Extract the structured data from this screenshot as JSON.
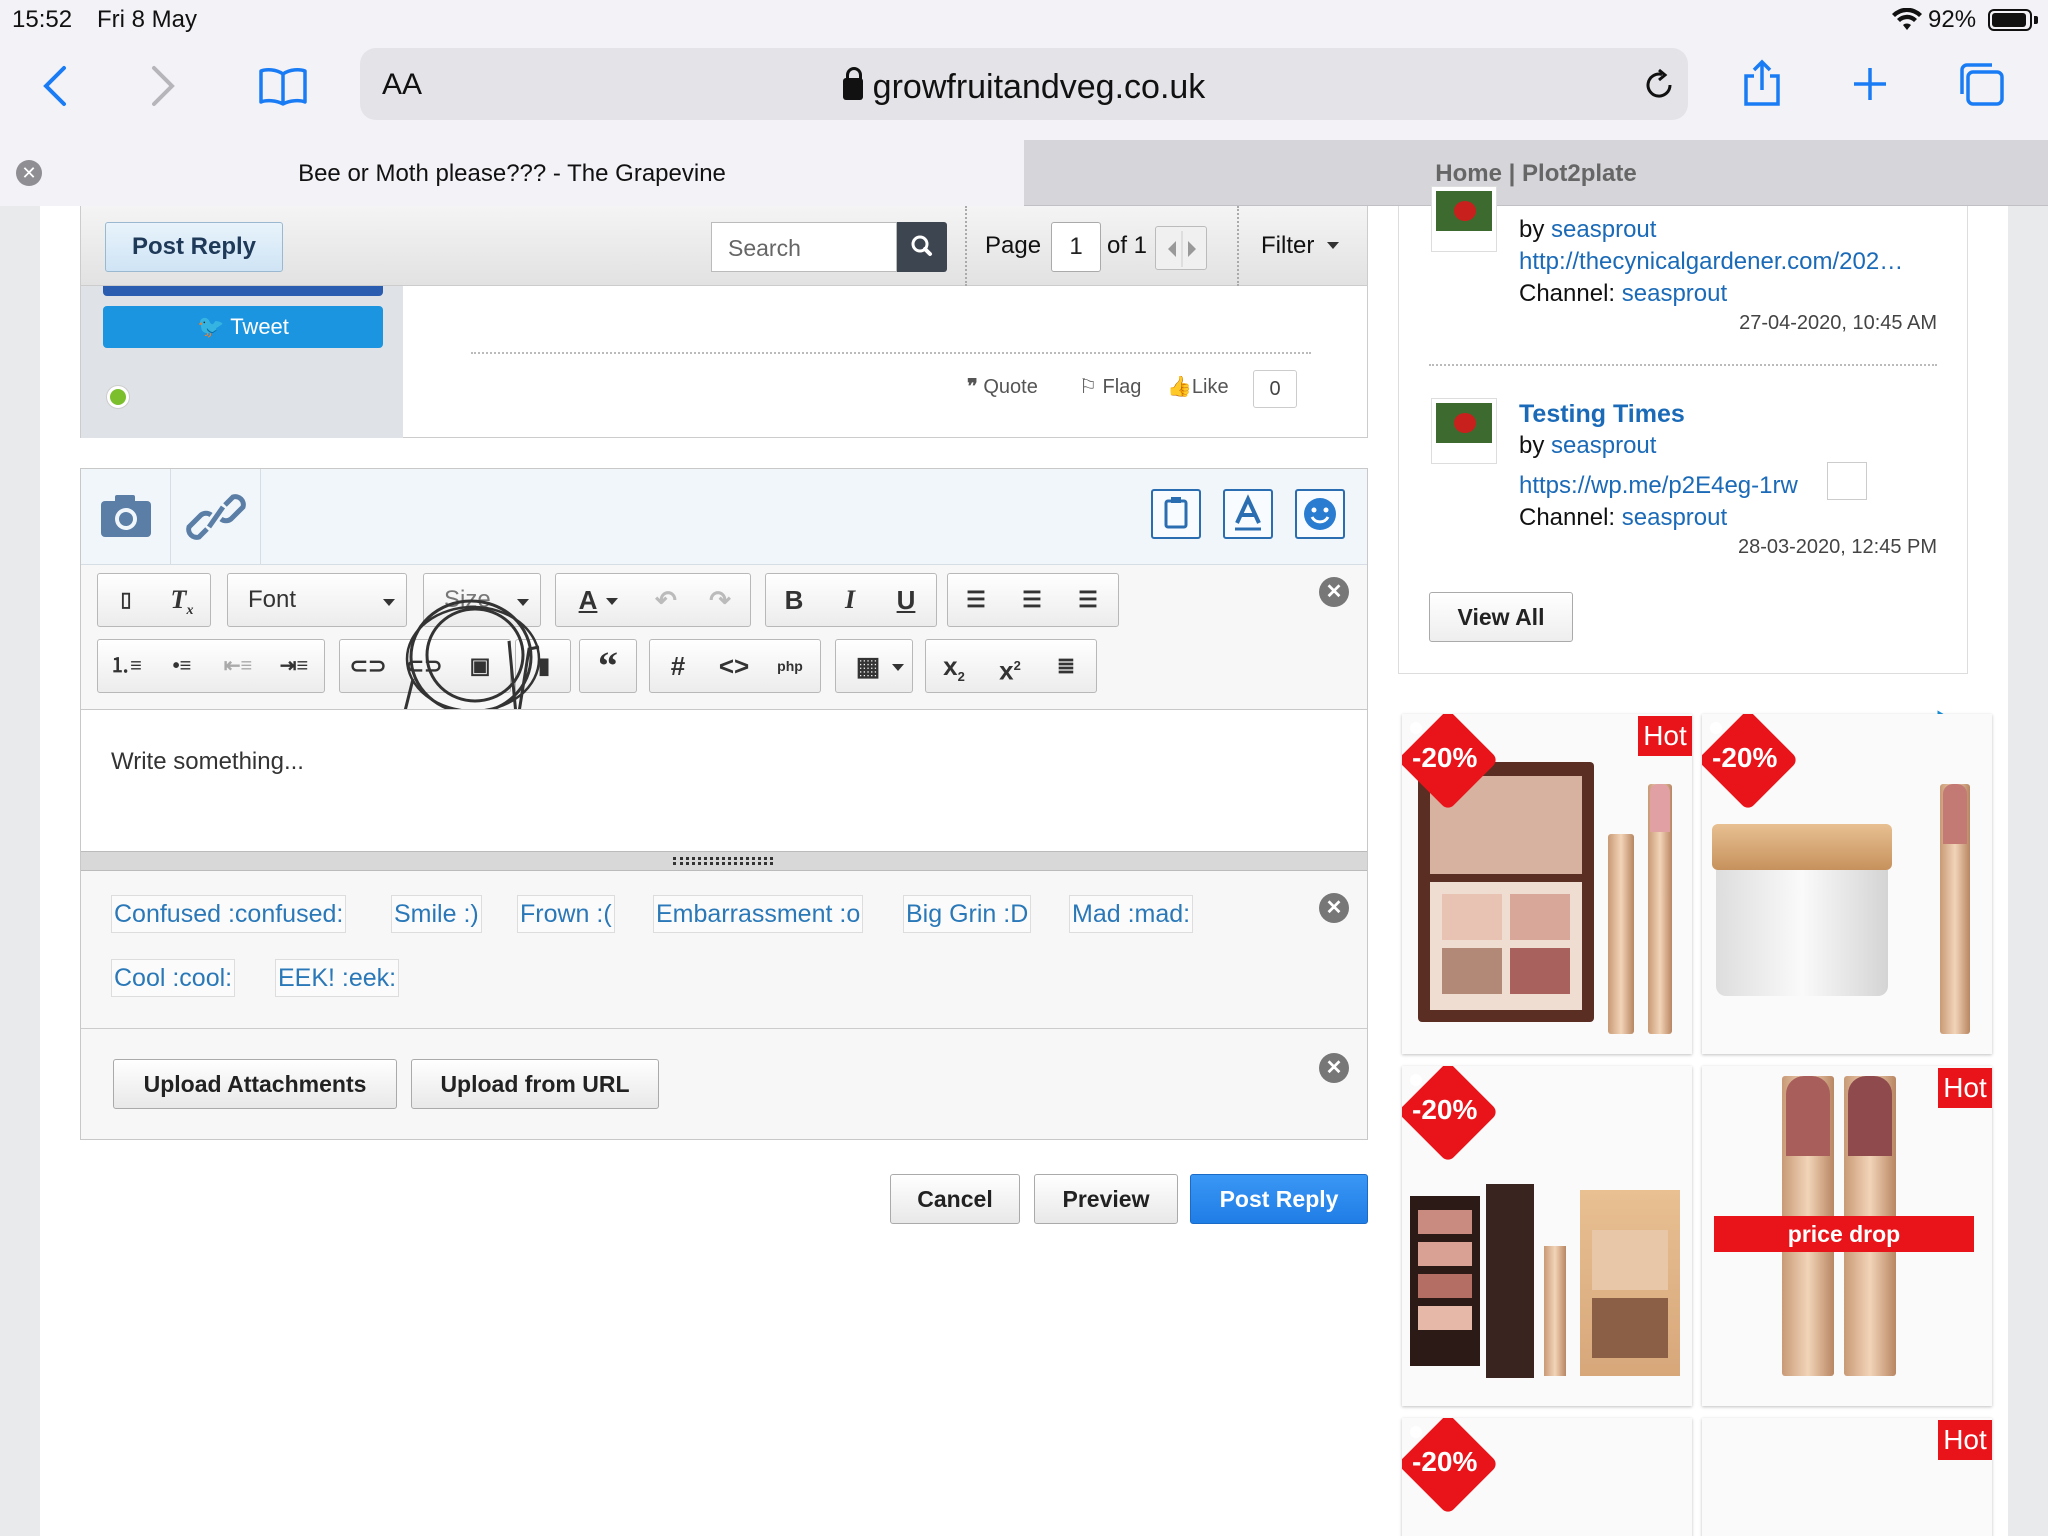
{
  "status_bar": {
    "time": "15:52",
    "date": "Fri 8 May",
    "battery": "92%"
  },
  "browser": {
    "aa_label": "AA",
    "url": "growfruitandveg.co.uk",
    "tabs": [
      {
        "title": "Bee or Moth please??? - The Grapevine"
      },
      {
        "title": "Home | Plot2plate"
      }
    ]
  },
  "topic_bar": {
    "post_reply": "Post Reply",
    "search_placeholder": "Search",
    "page_label": "Page",
    "page_num": "1",
    "page_of": "of 1",
    "filter": "Filter"
  },
  "post": {
    "tweet": "Tweet",
    "quote": "Quote",
    "flag": "Flag",
    "like": "Like",
    "like_count": "0"
  },
  "editor": {
    "font_label": "Font",
    "size_label": "Size",
    "placeholder": "Write something...",
    "smilies": [
      "Confused :confused:",
      "Smile :)",
      "Frown :(",
      "Embarrassment :o",
      "Big Grin :D",
      "Mad :mad:",
      "Cool :cool:",
      "EEK! :eek:"
    ],
    "upload_attachments": "Upload Attachments",
    "upload_from_url": "Upload from URL"
  },
  "actions": {
    "cancel": "Cancel",
    "preview": "Preview",
    "post_reply": "Post Reply"
  },
  "sidebar": {
    "entries": [
      {
        "by_label": "by",
        "author": "seasprout",
        "link": "http://thecynicalgardener.com/202…",
        "channel_label": "Channel:",
        "channel": "seasprout",
        "date": "27-04-2020, 10:45 AM"
      },
      {
        "title": "Testing Times",
        "by_label": "by",
        "author": "seasprout",
        "link": "https://wp.me/p2E4eg-1rw",
        "channel_label": "Channel:",
        "channel": "seasprout",
        "date": "28-03-2020, 12:45 PM"
      }
    ],
    "view_all": "View All"
  },
  "ads": {
    "discount": "-20%",
    "hot": "Hot",
    "price_drop": "price drop"
  },
  "colors": {
    "link_blue": "#1a6ab8",
    "safari_blue": "#1a7cf5",
    "ad_red": "#e8141a"
  }
}
